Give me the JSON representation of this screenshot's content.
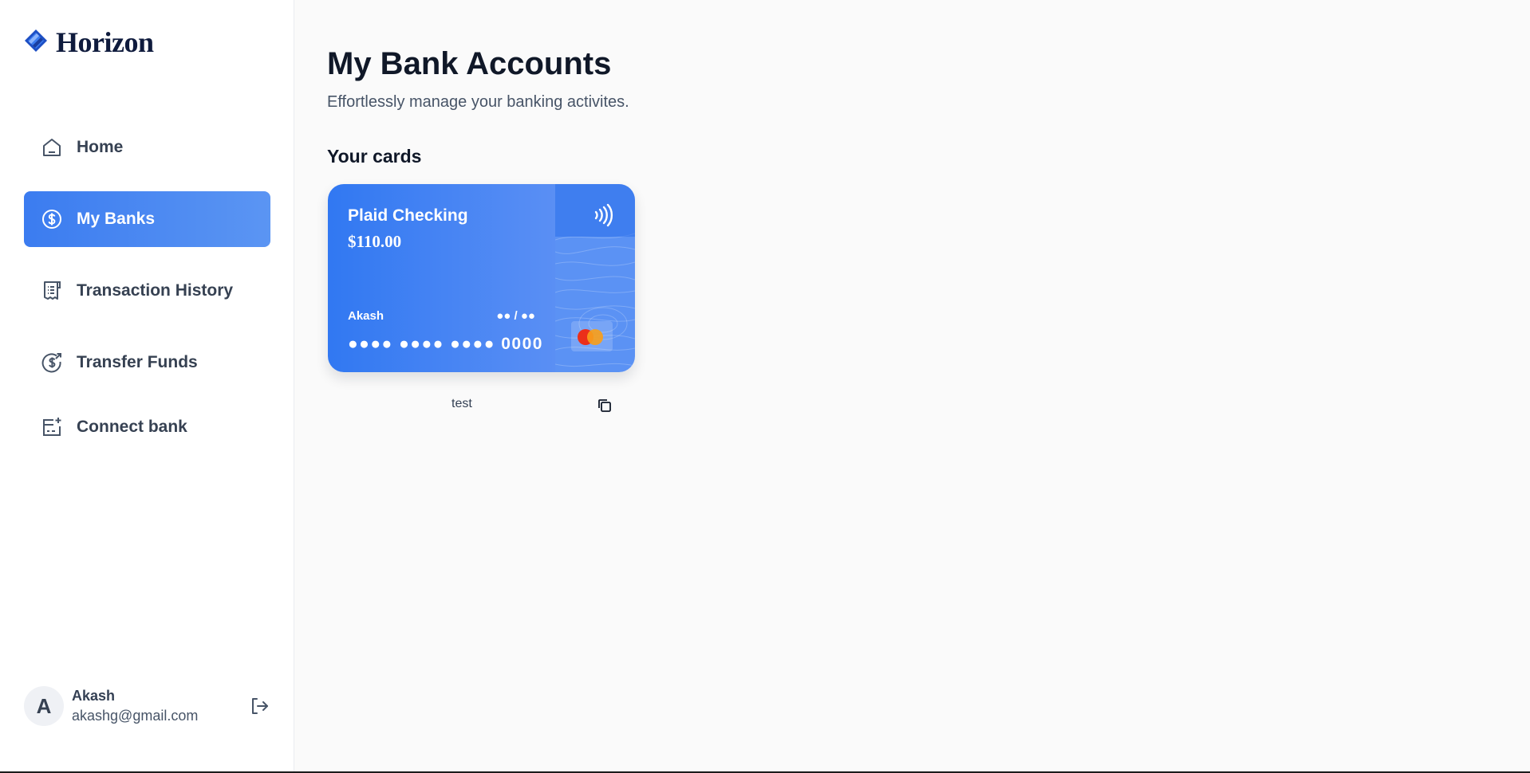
{
  "app": {
    "brand": "Horizon"
  },
  "sidebar": {
    "items": [
      {
        "label": "Home",
        "icon": "home-icon",
        "active": false
      },
      {
        "label": "My Banks",
        "icon": "dollar-circle-icon",
        "active": true
      },
      {
        "label": "Transaction History",
        "icon": "receipt-icon",
        "active": false
      },
      {
        "label": "Transfer Funds",
        "icon": "money-send-icon",
        "active": false
      },
      {
        "label": "Connect bank",
        "icon": "card-add-icon",
        "active": false
      }
    ],
    "user": {
      "initial": "A",
      "name": "Akash",
      "email": "akashg@gmail.com"
    }
  },
  "main": {
    "title": "My Bank Accounts",
    "subtitle": "Effortlessly manage your banking activites.",
    "section_title": "Your cards"
  },
  "card": {
    "name": "Plaid Checking",
    "balance": "$110.00",
    "holder": "Akash",
    "expiry": "●● / ●●",
    "number": "●●●● ●●●● ●●●● 0000",
    "caption": "test",
    "network": "mastercard-icon"
  },
  "colors": {
    "accent": "#3b7cf0",
    "card_gradient_start": "#3178f2",
    "card_gradient_end": "#5a8ff4",
    "brand_text": "#0f1b3d"
  }
}
